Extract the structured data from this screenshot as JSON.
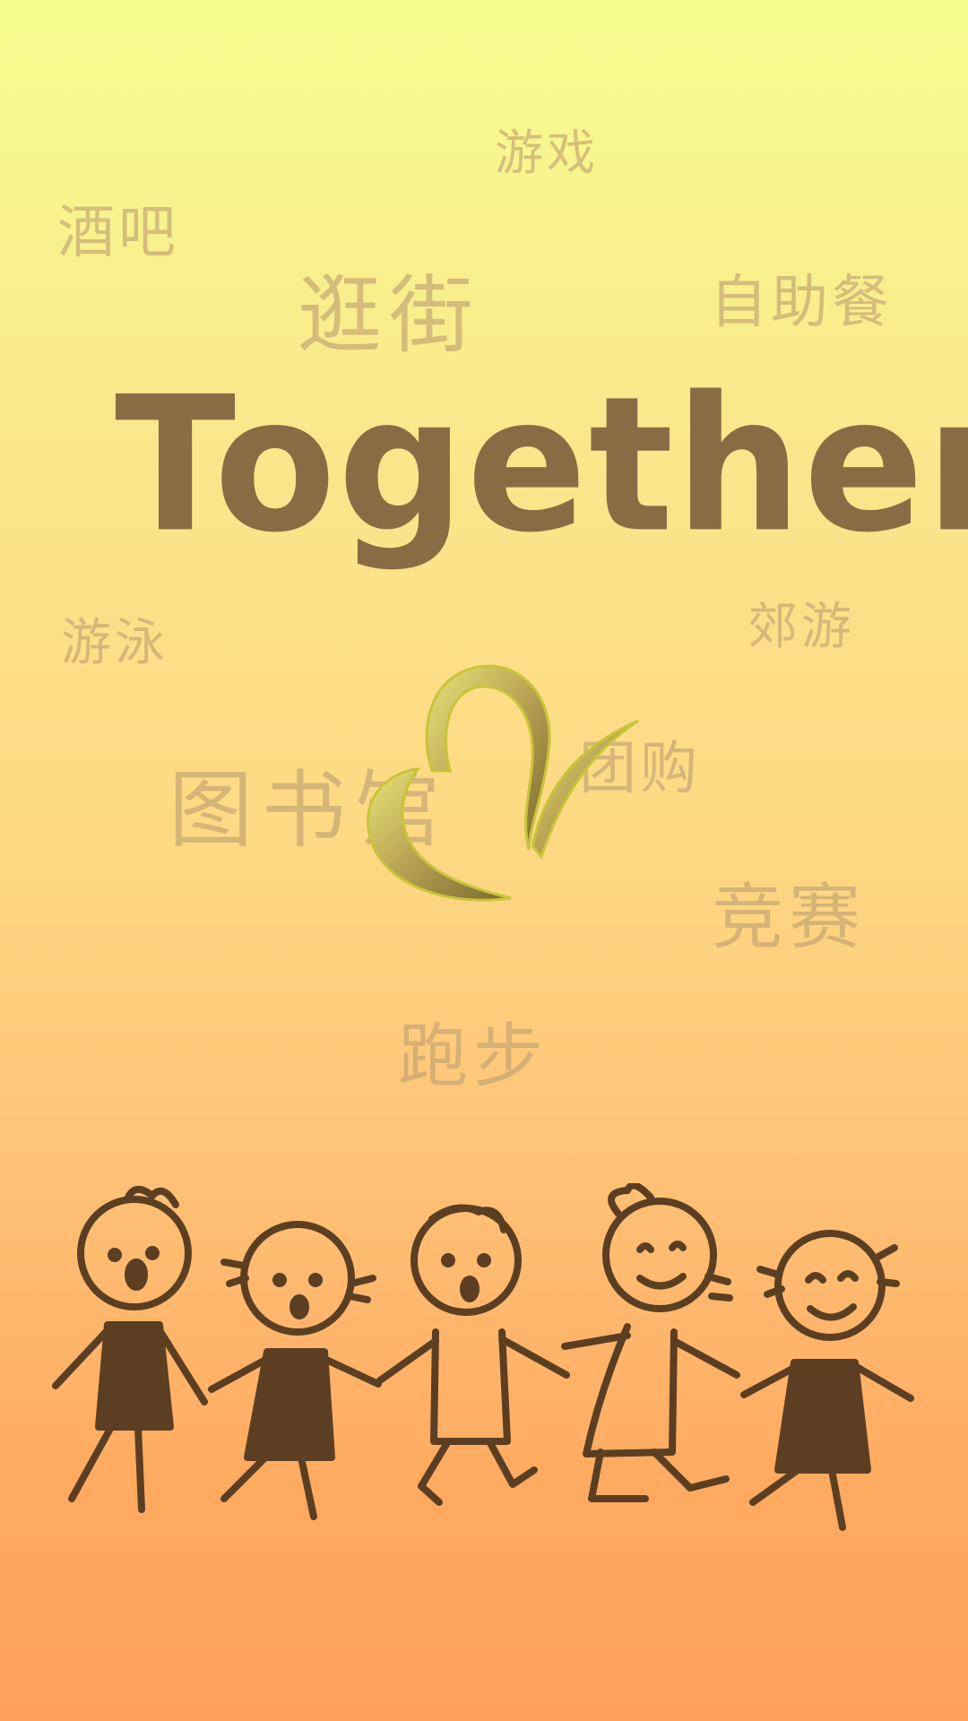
{
  "app": {
    "title": "Together"
  },
  "activity_tags": {
    "games": "游戏",
    "bar": "酒吧",
    "shopping": "逛街",
    "buffet": "自助餐",
    "swimming": "游泳",
    "outing": "郊游",
    "library": "图书馆",
    "group_buy": "团购",
    "contest": "竞赛",
    "running": "跑步"
  },
  "colors": {
    "background_top": "#f7fd8f",
    "background_bottom": "#ffa15c",
    "title": "#8a6c44",
    "tag_text": "#bfa071",
    "illustration": "#5c3f22"
  },
  "icons": {
    "logo_mark": "heart-icon",
    "illustration": "kids-holding-hands"
  }
}
